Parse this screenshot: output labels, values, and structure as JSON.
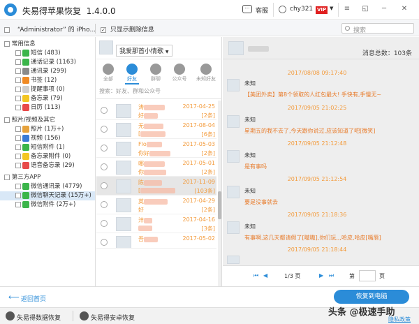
{
  "app": {
    "title": "失易得苹果恢复",
    "version": "1.4.0.0"
  },
  "header": {
    "service": "客服",
    "username": "chy321",
    "vip": "VIP"
  },
  "toolbar": {
    "device": "“Administrator” 的 iPho...",
    "only_deleted": "只显示删除信息",
    "search_placeholder": "搜索"
  },
  "sidebar": {
    "groups": [
      {
        "label": "常用信息",
        "items": [
          {
            "label": "短信 (483)",
            "color": "#3bb54a"
          },
          {
            "label": "通话记录 (1163)",
            "color": "#3bb54a"
          },
          {
            "label": "通讯录 (299)",
            "color": "#8a8a8a"
          },
          {
            "label": "书签 (12)",
            "color": "#f08a24"
          },
          {
            "label": "提醒事项 (0)",
            "color": "#cfcfcf"
          },
          {
            "label": "备忘录 (79)",
            "color": "#f3c623"
          },
          {
            "label": "日历 (113)",
            "color": "#e84a4a"
          }
        ]
      },
      {
        "label": "照片/视频及其它",
        "items": [
          {
            "label": "照片 (1万+)",
            "color": "#e6a23c"
          },
          {
            "label": "视频 (156)",
            "color": "#3a7bd5"
          },
          {
            "label": "短信附件 (1)",
            "color": "#3bb54a"
          },
          {
            "label": "备忘录附件 (0)",
            "color": "#f3c623"
          },
          {
            "label": "语音备忘录 (29)",
            "color": "#e84a4a"
          }
        ]
      },
      {
        "label": "第三方APP",
        "items": [
          {
            "label": "微信通讯录 (4779)",
            "color": "#3bb54a"
          },
          {
            "label": "微信聊天记录 (15万+)",
            "color": "#3bb54a"
          },
          {
            "label": "微信附件 (2万+)",
            "color": "#3bb54a"
          }
        ]
      }
    ]
  },
  "middle": {
    "account": "我爱那首小情歌",
    "tabs": [
      "全部",
      "好友",
      "群聊",
      "公众号",
      "未知好友"
    ],
    "search_placeholder": "搜索：好友、群和公众号",
    "rows": [
      {
        "name": "涛",
        "preview": "好",
        "date": "2017-04-25",
        "count": "[2条]"
      },
      {
        "name": "无",
        "preview": "[",
        "date": "2017-08-04",
        "count": "[6条]"
      },
      {
        "name": "Flo",
        "preview": "你好",
        "date": "2017-05-03",
        "count": "[2条]"
      },
      {
        "name": "哪",
        "preview": "你",
        "date": "2017-05-01",
        "count": "[2条]"
      },
      {
        "name": "陈",
        "preview": "[",
        "date": "2017-11-09",
        "count": "[103条]"
      },
      {
        "name": "英",
        "preview": "好",
        "date": "2017-04-29",
        "count": "[2条]"
      },
      {
        "name": "沣",
        "preview": "",
        "date": "2017-04-16",
        "count": "[3条]"
      },
      {
        "name": "吾",
        "preview": "",
        "date": "2017-05-02",
        "count": ""
      }
    ]
  },
  "chat": {
    "total": "消息总数：103条",
    "messages": [
      {
        "time": "2017/08/08 09:17:40",
        "name": "未知",
        "text": "【美团外卖】第8个领取的人红包最大! 手快有,手慢无~"
      },
      {
        "time": "2017/09/05 21:02:25",
        "name": "未知",
        "text": "星期五的我不去了,今天跟你说过,应该知道了吧[微笑]"
      },
      {
        "time": "2017/09/05 21:12:48",
        "name": "未知",
        "text": "是有事吗"
      },
      {
        "time": "2017/09/05 21:12:54",
        "name": "未知",
        "text": "要是没事就去"
      },
      {
        "time": "2017/09/05 21:18:36",
        "name": "未知",
        "text": "有事啊,这几天都请假了[嗷嗷],你们玩,,,哈皮,哈皮[嘴唇]"
      },
      {
        "time": "2017/09/05 21:18:44",
        "name": "",
        "text": ""
      }
    ],
    "pager": {
      "page": "1/3 页",
      "goto_label": "第",
      "goto_unit": "页"
    }
  },
  "bottom": {
    "back": "返回首页",
    "recover": "恢复到电脑"
  },
  "footer": {
    "item1": "失易得数据恢复",
    "item2": "失易得安卓恢复",
    "watermark": "头条 @极速手助",
    "privacy": "隐私政策"
  }
}
